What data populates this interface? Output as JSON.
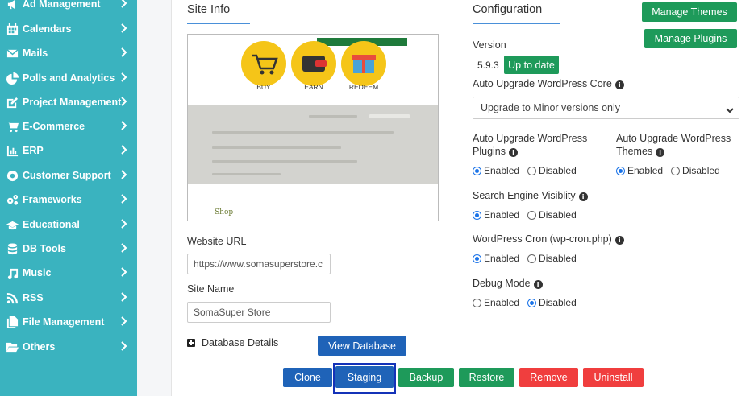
{
  "sidebar": {
    "items": [
      {
        "label": "Ad Management",
        "icon": "megaphone-icon"
      },
      {
        "label": "Calendars",
        "icon": "calendar-icon"
      },
      {
        "label": "Mails",
        "icon": "mail-icon"
      },
      {
        "label": "Polls and Analytics",
        "icon": "pie-chart-icon"
      },
      {
        "label": "Project Management",
        "icon": "edit-icon"
      },
      {
        "label": "E-Commerce",
        "icon": "cart-icon"
      },
      {
        "label": "ERP",
        "icon": "bar-chart-icon"
      },
      {
        "label": "Customer Support",
        "icon": "lifebuoy-icon"
      },
      {
        "label": "Frameworks",
        "icon": "cogs-icon"
      },
      {
        "label": "Educational",
        "icon": "graduation-cap-icon"
      },
      {
        "label": "DB Tools",
        "icon": "database-icon"
      },
      {
        "label": "Music",
        "icon": "music-icon"
      },
      {
        "label": "RSS",
        "icon": "rss-icon"
      },
      {
        "label": "File Management",
        "icon": "files-icon"
      },
      {
        "label": "Others",
        "icon": "folder-open-icon"
      }
    ]
  },
  "site_info": {
    "title": "Site Info",
    "preview": {
      "buy": "BUY",
      "earn": "EARN",
      "redeem": "REDEEM",
      "shop": "Shop"
    },
    "website_url_label": "Website URL",
    "website_url_value": "https://www.somasuperstore.c",
    "site_name_label": "Site Name",
    "site_name_value": "SomaSuper Store",
    "database_details_label": "Database Details",
    "view_database_label": "View Database"
  },
  "configuration": {
    "title": "Configuration",
    "manage_themes_label": "Manage Themes",
    "manage_plugins_label": "Manage Plugins",
    "version_label": "Version",
    "version_value": "5.9.3",
    "up_to_date_label": "Up to date",
    "auto_upgrade_core_label": "Auto Upgrade WordPress Core",
    "auto_upgrade_core_value": "Upgrade to Minor versions only",
    "auto_upgrade_plugins_label_1": "Auto Upgrade WordPress",
    "auto_upgrade_plugins_label_2": "Plugins",
    "auto_upgrade_themes_label_1": "Auto Upgrade WordPress",
    "auto_upgrade_themes_label_2": "Themes",
    "search_visibility_label": "Search Engine Visiblity",
    "wp_cron_label": "WordPress Cron (wp-cron.php)",
    "debug_mode_label": "Debug Mode",
    "enabled": "Enabled",
    "disabled": "Disabled"
  },
  "actions": {
    "clone": "Clone",
    "staging": "Staging",
    "backup": "Backup",
    "restore": "Restore",
    "remove": "Remove",
    "uninstall": "Uninstall"
  },
  "colors": {
    "sidebar": "#3ab3bf",
    "green": "#1e9a5a",
    "blue": "#1f63b8",
    "red": "#f03e3e"
  }
}
